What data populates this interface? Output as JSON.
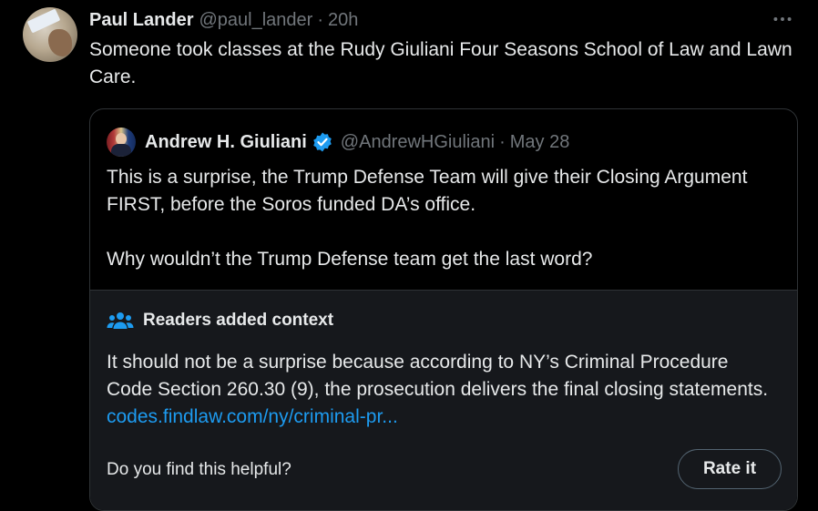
{
  "tweet": {
    "display_name": "Paul Lander",
    "handle": "@paul_lander",
    "separator": "·",
    "time": "20h",
    "more_icon": "more-horizontal-icon",
    "text": "Someone took classes at the Rudy Giuliani Four Seasons School of Law and Lawn Care."
  },
  "quote": {
    "display_name": "Andrew H. Giuliani",
    "verified": true,
    "handle": "@AndrewHGiuliani",
    "separator": "·",
    "date": "May 28",
    "paragraph_1": "This is a surprise, the Trump Defense Team will give their Closing Argument FIRST, before the Soros funded DA’s office.",
    "paragraph_2": "Why wouldn’t the Trump Defense team get the last word?"
  },
  "context": {
    "icon": "people-icon",
    "title": "Readers added context",
    "text": "It should not be a surprise because according to NY’s Criminal Procedure Code Section 260.30 (9), the prosecution delivers the final closing statements.",
    "link": "codes.findlaw.com/ny/criminal-pr...",
    "helpful_prompt": "Do you find this helpful?",
    "rate_button": "Rate it"
  },
  "colors": {
    "background": "#000000",
    "text": "#e7e9ea",
    "muted": "#71767b",
    "link": "#1d9bf0",
    "verified": "#1d9bf0",
    "context_bg": "#16181c",
    "border": "#2f3336"
  }
}
